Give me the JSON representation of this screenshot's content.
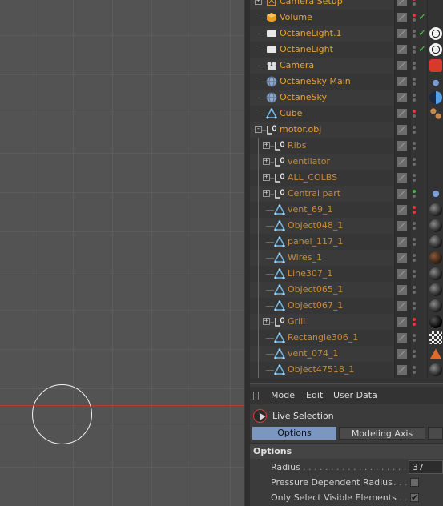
{
  "object_manager": {
    "rows": [
      {
        "label": "Camera Setup",
        "style": "top",
        "icon": "camera-setup-icon",
        "level": 0,
        "expander": "+",
        "dots": [
          "red",
          "gray"
        ],
        "check": false,
        "tag": "none"
      },
      {
        "label": "Volume",
        "style": "top",
        "icon": "volume-icon",
        "level": 0,
        "expander": "",
        "dots": [
          "red",
          "gray"
        ],
        "check": true,
        "tag": "none"
      },
      {
        "label": "OctaneLight.1",
        "style": "top",
        "icon": "light-icon",
        "level": 0,
        "expander": "",
        "dots": [
          "gray",
          "gray"
        ],
        "check": true,
        "tag": "light-tag"
      },
      {
        "label": "OctaneLight",
        "style": "top",
        "icon": "light-icon",
        "level": 0,
        "expander": "",
        "dots": [
          "gray",
          "gray"
        ],
        "check": true,
        "tag": "light-tag"
      },
      {
        "label": "Camera",
        "style": "top",
        "icon": "camera-icon",
        "level": 0,
        "expander": "",
        "dots": [
          "gray",
          "gray"
        ],
        "check": false,
        "tag": "camera-tag"
      },
      {
        "label": "OctaneSky Main",
        "style": "top",
        "icon": "sky-icon",
        "level": 0,
        "expander": "",
        "dots": [
          "gray",
          "gray"
        ],
        "check": false,
        "tag": "sky-main-tag"
      },
      {
        "label": "OctaneSky",
        "style": "top",
        "icon": "sky-icon",
        "level": 0,
        "expander": "",
        "dots": [
          "gray",
          "gray"
        ],
        "check": false,
        "tag": "sky-tag"
      },
      {
        "label": "Cube",
        "style": "top",
        "icon": "polygon-icon",
        "level": 0,
        "expander": "",
        "dots": [
          "red",
          "gray"
        ],
        "check": false,
        "tag": "spheres-tag"
      },
      {
        "label": "motor.obj",
        "style": "top",
        "icon": "null-icon",
        "level": 0,
        "expander": "-",
        "dots": [
          "gray",
          "gray"
        ],
        "check": false,
        "tag": "none"
      },
      {
        "label": "Ribs",
        "style": "child",
        "icon": "null-icon",
        "level": 1,
        "expander": "+",
        "dots": [
          "gray",
          "gray"
        ],
        "check": false,
        "tag": "none"
      },
      {
        "label": "ventilator",
        "style": "child",
        "icon": "null-icon",
        "level": 1,
        "expander": "+",
        "dots": [
          "gray",
          "gray"
        ],
        "check": false,
        "tag": "none"
      },
      {
        "label": "ALL_COLBS",
        "style": "child",
        "icon": "null-icon",
        "level": 1,
        "expander": "+",
        "dots": [
          "gray",
          "gray"
        ],
        "check": false,
        "tag": "none"
      },
      {
        "label": "Central part",
        "style": "child",
        "icon": "null-icon",
        "level": 1,
        "expander": "+",
        "dots": [
          "green",
          "gray"
        ],
        "check": false,
        "tag": "blue-sphere-tag"
      },
      {
        "label": "vent_69_1",
        "style": "child",
        "icon": "polygon-icon",
        "level": 1,
        "expander": "",
        "dots": [
          "red",
          "red"
        ],
        "check": false,
        "tag": "dark-sphere-tag"
      },
      {
        "label": "Object048_1",
        "style": "child",
        "icon": "polygon-icon",
        "level": 1,
        "expander": "",
        "dots": [
          "gray",
          "gray"
        ],
        "check": false,
        "tag": "dark-sphere-tag"
      },
      {
        "label": "panel_117_1",
        "style": "child",
        "icon": "polygon-icon",
        "level": 1,
        "expander": "",
        "dots": [
          "gray",
          "gray"
        ],
        "check": false,
        "tag": "dark-sphere-tag"
      },
      {
        "label": "Wires_1",
        "style": "child",
        "icon": "polygon-icon",
        "level": 1,
        "expander": "",
        "dots": [
          "gray",
          "gray"
        ],
        "check": false,
        "tag": "brown-sphere-tag"
      },
      {
        "label": "Line307_1",
        "style": "child",
        "icon": "polygon-icon",
        "level": 1,
        "expander": "",
        "dots": [
          "gray",
          "gray"
        ],
        "check": false,
        "tag": "dark-sphere-tag"
      },
      {
        "label": "Object065_1",
        "style": "child",
        "icon": "polygon-icon",
        "level": 1,
        "expander": "",
        "dots": [
          "gray",
          "gray"
        ],
        "check": false,
        "tag": "dark-sphere-tag"
      },
      {
        "label": "Object067_1",
        "style": "child",
        "icon": "polygon-icon",
        "level": 1,
        "expander": "",
        "dots": [
          "gray",
          "gray"
        ],
        "check": false,
        "tag": "dark-sphere-tag"
      },
      {
        "label": "Grill",
        "style": "child",
        "icon": "null-icon",
        "level": 1,
        "expander": "+",
        "dots": [
          "red",
          "red"
        ],
        "check": false,
        "tag": "black-sphere-tag"
      },
      {
        "label": "Rectangle306_1",
        "style": "child",
        "icon": "polygon-icon",
        "level": 1,
        "expander": "",
        "dots": [
          "gray",
          "gray"
        ],
        "check": false,
        "tag": "checker-tag"
      },
      {
        "label": "vent_074_1",
        "style": "child",
        "icon": "polygon-icon",
        "level": 1,
        "expander": "",
        "dots": [
          "gray",
          "gray"
        ],
        "check": false,
        "tag": "orange-cone-tag"
      },
      {
        "label": "Object47518_1",
        "style": "child",
        "icon": "polygon-icon",
        "level": 1,
        "expander": "",
        "dots": [
          "gray",
          "gray"
        ],
        "check": false,
        "tag": "dark-sphere-tag"
      }
    ]
  },
  "attribute_manager": {
    "menus": [
      "Mode",
      "Edit",
      "User Data"
    ],
    "tool_title": "Live Selection",
    "tabs": [
      {
        "label": "Options",
        "active": true
      },
      {
        "label": "Modeling Axis",
        "active": false
      }
    ],
    "section_title": "Options",
    "params": [
      {
        "label": "Radius",
        "type": "number",
        "value": "37"
      },
      {
        "label": "Pressure Dependent Radius",
        "type": "checkbox",
        "value": ""
      },
      {
        "label": "Only Select Visible Elements",
        "type": "checkbox",
        "value": "✔"
      }
    ]
  },
  "colors": {
    "top_label": "#e8a33a",
    "child_label": "#c58a3c",
    "active_tab": "#7b96bf",
    "axis_red": "#b83a3a"
  }
}
